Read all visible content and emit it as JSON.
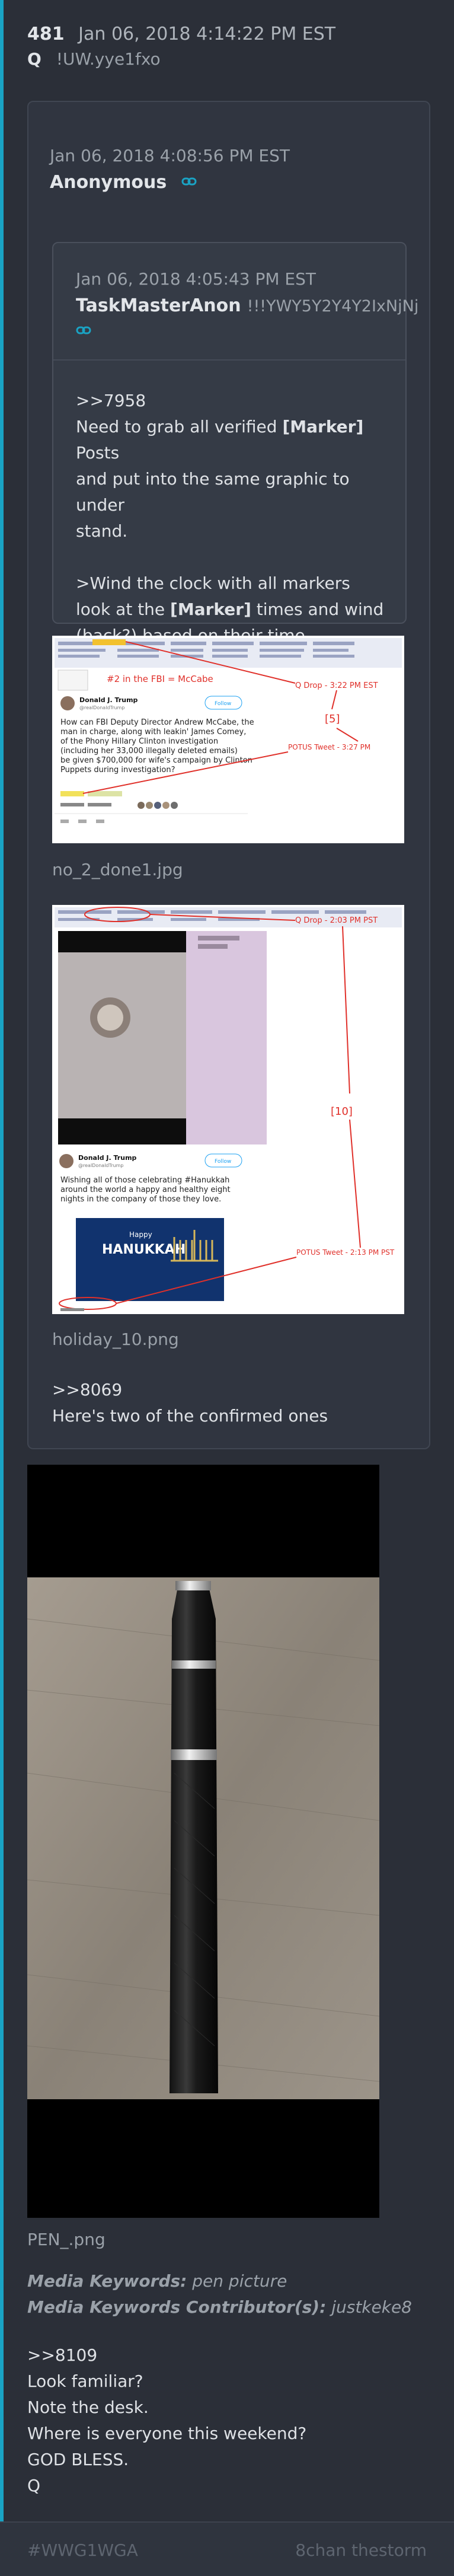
{
  "post": {
    "number": "481",
    "timestamp": "Jan 06, 2018 4:14:22 PM EST",
    "author": "Q",
    "tripcode": "!UW.yye1fxo"
  },
  "reply": {
    "timestamp": "Jan 06, 2018 4:08:56 PM EST",
    "author": "Anonymous",
    "link_icon": "link-icon"
  },
  "quoted": {
    "timestamp": "Jan 06, 2018 4:05:43 PM EST",
    "author": "TaskMasterAnon",
    "tripcode": "!!!YWY5Y2Y4Y2IxNjNj",
    "link_icon": "link-icon",
    "ref": ">>7958",
    "line1": "Need to grab all verified ",
    "marker": "[Marker]",
    "line1b": " Posts",
    "line2": "and put into the same graphic to under",
    "line3": "stand.",
    "line4": ">Wind the clock with all markers",
    "line5a": "look at the ",
    "line5b": " times and wind",
    "line6": "(back?) based on their time differences?"
  },
  "image1": {
    "filename": "no_2_done1.jpg",
    "banner": "#2 in the FBI = McCabe",
    "q_label": "Q Drop - 3:22 PM EST",
    "diff": "[5]",
    "potus_label": "POTUS Tweet - 3:27 PM",
    "tweet_author": "Donald J. Trump",
    "tweet_handle": "@realDonaldTrump",
    "follow": "Follow",
    "tweet_text": "How can FBI Deputy Director Andrew McCabe, the man in charge, along with leakin' James Comey, of the Phony Hillary Clinton investigation (including her 33,000 illegally deleted emails) be given $700,000 for wife's campaign by Clinton Puppets during investigation?"
  },
  "image2": {
    "filename": "holiday_10.png",
    "q_label": "Q Drop - 2:03 PM PST",
    "diff": "[10]",
    "potus_label": "POTUS Tweet - 2:13 PM PST",
    "tweet_author": "Donald J. Trump",
    "tweet_handle": "@realDonaldTrump",
    "follow": "Follow",
    "tweet_text": "Wishing all of those celebrating #Hanukkah around the world a happy and healthy eight nights in the company of those they love.",
    "card_happy": "Happy",
    "card_title": "HANUKKAH"
  },
  "closing": {
    "ref": ">>8069",
    "text": "Here's two of the confirmed ones"
  },
  "pen": {
    "filename": "PEN_.png",
    "kw_label": "Media Keywords:",
    "kw_value": "pen picture",
    "kwc_label": "Media Keywords Contributor(s):",
    "kwc_value": "justkeke8"
  },
  "message": {
    "ref": ">>8109",
    "l1": "Look familiar?",
    "l2": "Note the desk.",
    "l3": "Where is everyone this weekend?",
    "l4": "GOD BLESS.",
    "l5": "Q"
  },
  "footer": {
    "hashtag": "#WWG1WGA",
    "source": "8chan thestorm"
  },
  "colors": {
    "background": "#2b2f38",
    "card": "#303540",
    "accent": "#1aa3c4",
    "annotation_red": "#e0302a"
  }
}
